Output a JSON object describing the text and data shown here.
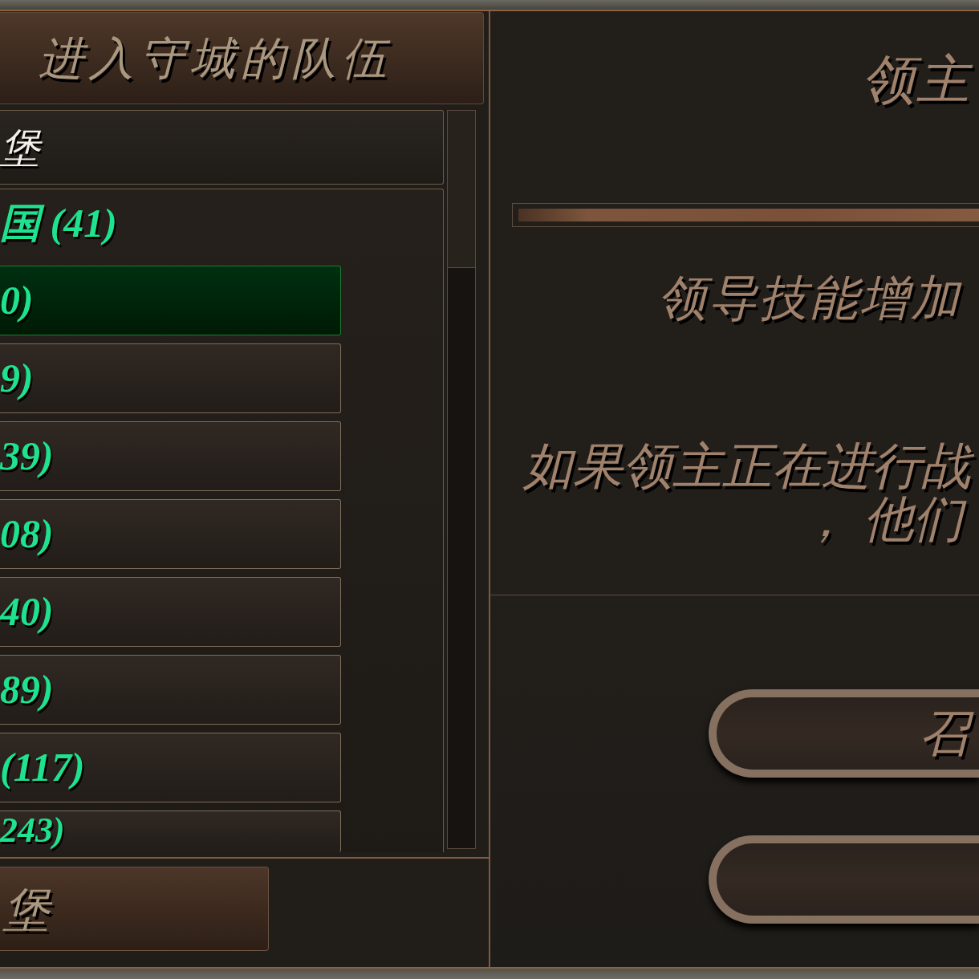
{
  "left_panel": {
    "title": "进入守城的队伍",
    "settlement": {
      "name": "堡"
    },
    "groups": [
      {
        "label": "国 (41)",
        "children": [
          {
            "label": "0)",
            "selected": true
          },
          {
            "label": "9)",
            "selected": false
          },
          {
            "label": "39)",
            "selected": false
          },
          {
            "label": "08)",
            "selected": false
          },
          {
            "label": "40)",
            "selected": false
          },
          {
            "label": "89)",
            "selected": false
          },
          {
            "label": "(117)",
            "selected": false
          },
          {
            "label": "243)",
            "selected": false
          }
        ]
      }
    ],
    "bottom_button": {
      "label": "堡"
    }
  },
  "right_panel": {
    "title": "领主",
    "effect": "领导技能增加",
    "description": [
      "如果领主正在进行战",
      "， 他们"
    ],
    "buttons": [
      {
        "kind": "pill",
        "label": "召"
      },
      {
        "kind": "pill"
      }
    ]
  }
}
